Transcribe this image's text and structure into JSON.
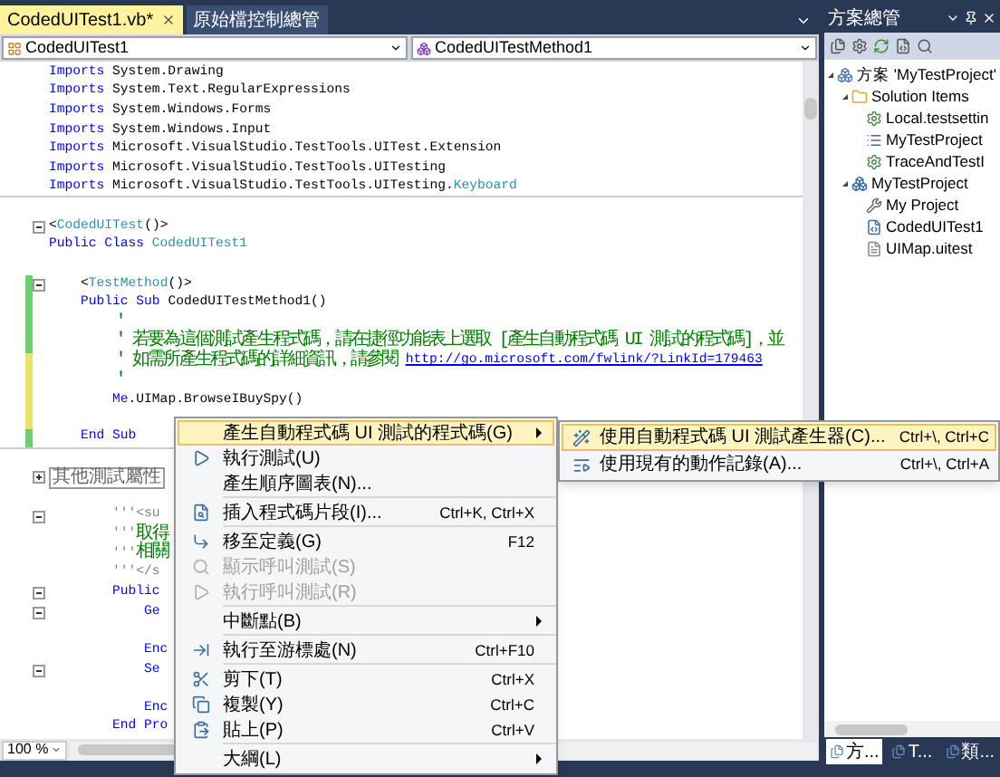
{
  "tabs": [
    {
      "label": "CodedUITest1.vb*",
      "selected": true
    },
    {
      "label": "原始檔控制總管",
      "selected": false
    }
  ],
  "type_dropdown": {
    "value": "CodedUITest1"
  },
  "member_dropdown": {
    "value": "CodedUITestMethod1"
  },
  "code_lines": [
    {
      "kind": "code",
      "segments": [
        {
          "kind": "keyword",
          "text": "Imports"
        },
        {
          "kind": "plain",
          "text": " System.Drawing"
        }
      ]
    },
    {
      "kind": "code",
      "segments": [
        {
          "kind": "keyword",
          "text": "Imports"
        },
        {
          "kind": "plain",
          "text": " System.Text.RegularExpressions"
        }
      ]
    },
    {
      "kind": "code",
      "segments": [
        {
          "kind": "keyword",
          "text": "Imports"
        },
        {
          "kind": "plain",
          "text": " System.Windows.Forms"
        }
      ]
    },
    {
      "kind": "code",
      "segments": [
        {
          "kind": "keyword",
          "text": "Imports"
        },
        {
          "kind": "plain",
          "text": " System.Windows.Input"
        }
      ]
    },
    {
      "kind": "code",
      "segments": [
        {
          "kind": "keyword",
          "text": "Imports"
        },
        {
          "kind": "plain",
          "text": " Microsoft.VisualStudio.TestTools.UITest.Extension"
        }
      ]
    },
    {
      "kind": "code",
      "segments": [
        {
          "kind": "keyword",
          "text": "Imports"
        },
        {
          "kind": "plain",
          "text": " Microsoft.VisualStudio.TestTools.UITesting"
        }
      ]
    },
    {
      "kind": "code",
      "separator": true,
      "segments": [
        {
          "kind": "keyword",
          "text": "Imports"
        },
        {
          "kind": "plain",
          "text": " Microsoft.VisualStudio.TestTools.UITesting."
        },
        {
          "kind": "type",
          "text": "Keyboard"
        }
      ]
    },
    {
      "kind": "blank"
    },
    {
      "kind": "code",
      "foldable": true,
      "segments": [
        {
          "kind": "plain",
          "text": "<"
        },
        {
          "kind": "type",
          "text": "CodedUITest"
        },
        {
          "kind": "plain",
          "text": "()>"
        }
      ]
    },
    {
      "kind": "code",
      "segments": [
        {
          "kind": "keyword",
          "text": "Public Class"
        },
        {
          "kind": "type",
          "text": " CodedUITest1"
        }
      ]
    },
    {
      "kind": "blank"
    },
    {
      "kind": "code",
      "foldable": true,
      "changed": true,
      "saved": true,
      "segments": [
        {
          "kind": "plain",
          "text": "    <"
        },
        {
          "kind": "type",
          "text": "TestMethod"
        },
        {
          "kind": "plain",
          "text": "()>"
        }
      ]
    },
    {
      "kind": "code",
      "changed": true,
      "saved": true,
      "segments": [
        {
          "kind": "keyword",
          "text": "    Public Sub"
        },
        {
          "kind": "plain",
          "text": " CodedUITestMethod1()"
        }
      ]
    },
    {
      "kind": "code",
      "changed": true,
      "saved": true,
      "segments": [
        {
          "kind": "comment",
          "text": "        '"
        }
      ]
    },
    {
      "kind": "code",
      "changed": true,
      "saved": true,
      "segments": [
        {
          "kind": "comment",
          "text": "        ' 若要為這個測試產生程式碼，請在捷徑功能表上選取 [產生自動程式碼 UI 測試的程式碼]，並"
        }
      ]
    },
    {
      "kind": "code",
      "changed": true,
      "saved": false,
      "segments": [
        {
          "kind": "comment",
          "text": "        ' 如需所產生程式碼的詳細資訊，請參閱 "
        },
        {
          "kind": "link",
          "text": "http://go.microsoft.com/fwlink/?LinkId=179463"
        }
      ]
    },
    {
      "kind": "code",
      "changed": true,
      "saved": false,
      "segments": [
        {
          "kind": "comment",
          "text": "        '"
        }
      ]
    },
    {
      "kind": "code",
      "changed": true,
      "saved": false,
      "segments": [
        {
          "kind": "keyword",
          "text": "        Me"
        },
        {
          "kind": "plain",
          "text": ".UIMap.BrowseIBuySpy()"
        }
      ]
    },
    {
      "kind": "blank",
      "changed": true,
      "saved": false
    },
    {
      "kind": "code",
      "changed": true,
      "saved": true,
      "separator": true,
      "segments": [
        {
          "kind": "keyword",
          "text": "    End Sub"
        }
      ]
    },
    {
      "kind": "blank"
    },
    {
      "kind": "region",
      "foldable": true,
      "text": "其他測試屬性"
    },
    {
      "kind": "blank"
    },
    {
      "kind": "code",
      "foldable": true,
      "segments": [
        {
          "kind": "doc",
          "text": "        '''<su"
        }
      ]
    },
    {
      "kind": "code",
      "segments": [
        {
          "kind": "doc",
          "text": "        '''"
        },
        {
          "kind": "comment",
          "text": "取得"
        }
      ]
    },
    {
      "kind": "code",
      "segments": [
        {
          "kind": "doc",
          "text": "        '''"
        },
        {
          "kind": "comment",
          "text": "相關"
        }
      ]
    },
    {
      "kind": "code",
      "segments": [
        {
          "kind": "doc",
          "text": "        '''</s"
        }
      ]
    },
    {
      "kind": "code",
      "foldable": true,
      "segments": [
        {
          "kind": "keyword",
          "text": "        Public"
        }
      ]
    },
    {
      "kind": "code",
      "foldable": true,
      "segments": [
        {
          "kind": "keyword",
          "text": "            Ge"
        }
      ]
    },
    {
      "kind": "blank"
    },
    {
      "kind": "code",
      "segments": [
        {
          "kind": "keyword",
          "text": "            Enc"
        }
      ]
    },
    {
      "kind": "code",
      "foldable": true,
      "segments": [
        {
          "kind": "keyword",
          "text": "            Se"
        }
      ]
    },
    {
      "kind": "blank"
    },
    {
      "kind": "code",
      "segments": [
        {
          "kind": "keyword",
          "text": "            Enc"
        }
      ]
    },
    {
      "kind": "code",
      "segments": [
        {
          "kind": "keyword",
          "text": "        End Pro"
        }
      ]
    }
  ],
  "zoom": "100 %",
  "context_menu": [
    {
      "kind": "item",
      "label": "產生自動程式碼 UI 測試的程式碼(G)",
      "submenu": true,
      "selected": true,
      "disabled": false
    },
    {
      "kind": "item",
      "label": "執行測試(U)",
      "submenu": false,
      "selected": false,
      "disabled": false
    },
    {
      "kind": "item",
      "label": "產生順序圖表(N)...",
      "submenu": false,
      "selected": false,
      "disabled": false
    },
    {
      "kind": "separator"
    },
    {
      "kind": "item",
      "label": "插入程式碼片段(I)...",
      "shortcut": "Ctrl+K, Ctrl+X",
      "submenu": false,
      "selected": false,
      "disabled": false
    },
    {
      "kind": "separator"
    },
    {
      "kind": "item",
      "label": "移至定義(G)",
      "shortcut": "F12",
      "submenu": false,
      "selected": false,
      "disabled": false
    },
    {
      "kind": "item",
      "label": "顯示呼叫測試(S)",
      "submenu": false,
      "selected": false,
      "disabled": true
    },
    {
      "kind": "item",
      "label": "執行呼叫測試(R)",
      "submenu": false,
      "selected": false,
      "disabled": true
    },
    {
      "kind": "separator"
    },
    {
      "kind": "item",
      "label": "中斷點(B)",
      "submenu": true,
      "selected": false,
      "disabled": false
    },
    {
      "kind": "separator"
    },
    {
      "kind": "item",
      "label": "執行至游標處(N)",
      "shortcut": "Ctrl+F10",
      "submenu": false,
      "selected": false,
      "disabled": false
    },
    {
      "kind": "separator"
    },
    {
      "kind": "item",
      "label": "剪下(T)",
      "shortcut": "Ctrl+X",
      "submenu": false,
      "selected": false,
      "disabled": false
    },
    {
      "kind": "item",
      "label": "複製(Y)",
      "shortcut": "Ctrl+C",
      "submenu": false,
      "selected": false,
      "disabled": false
    },
    {
      "kind": "item",
      "label": "貼上(P)",
      "shortcut": "Ctrl+V",
      "submenu": false,
      "selected": false,
      "disabled": false
    },
    {
      "kind": "separator"
    },
    {
      "kind": "item",
      "label": "大綱(L)",
      "submenu": true,
      "selected": false,
      "disabled": false
    }
  ],
  "submenu": [
    {
      "label": "使用自動程式碼 UI 測試產生器(C)...",
      "shortcut": "Ctrl+\\, Ctrl+C",
      "selected": true
    },
    {
      "label": "使用現有的動作記錄(A)...",
      "shortcut": "Ctrl+\\, Ctrl+A",
      "selected": false
    }
  ],
  "solution_explorer": {
    "title": "方案總管",
    "tree": [
      {
        "kind": "solution",
        "label": "方案 'MyTestProject'",
        "expanded": true,
        "children": [
          {
            "kind": "folder",
            "label": "Solution Items",
            "expanded": true,
            "children": [
              {
                "kind": "settings",
                "label": "Local.testsettin"
              },
              {
                "kind": "list",
                "label": "MyTestProject"
              },
              {
                "kind": "settings",
                "label": "TraceAndTestI"
              }
            ]
          },
          {
            "kind": "project",
            "label": "MyTestProject",
            "expanded": true,
            "children": [
              {
                "kind": "properties",
                "label": "My Project"
              },
              {
                "kind": "code",
                "label": "CodedUITest1"
              },
              {
                "kind": "file",
                "label": "UIMap.uitest"
              }
            ]
          }
        ]
      }
    ],
    "bottom_tabs": [
      {
        "label": "方...",
        "selected": true
      },
      {
        "label": "T...",
        "selected": false
      },
      {
        "label": "類...",
        "selected": false
      }
    ]
  }
}
